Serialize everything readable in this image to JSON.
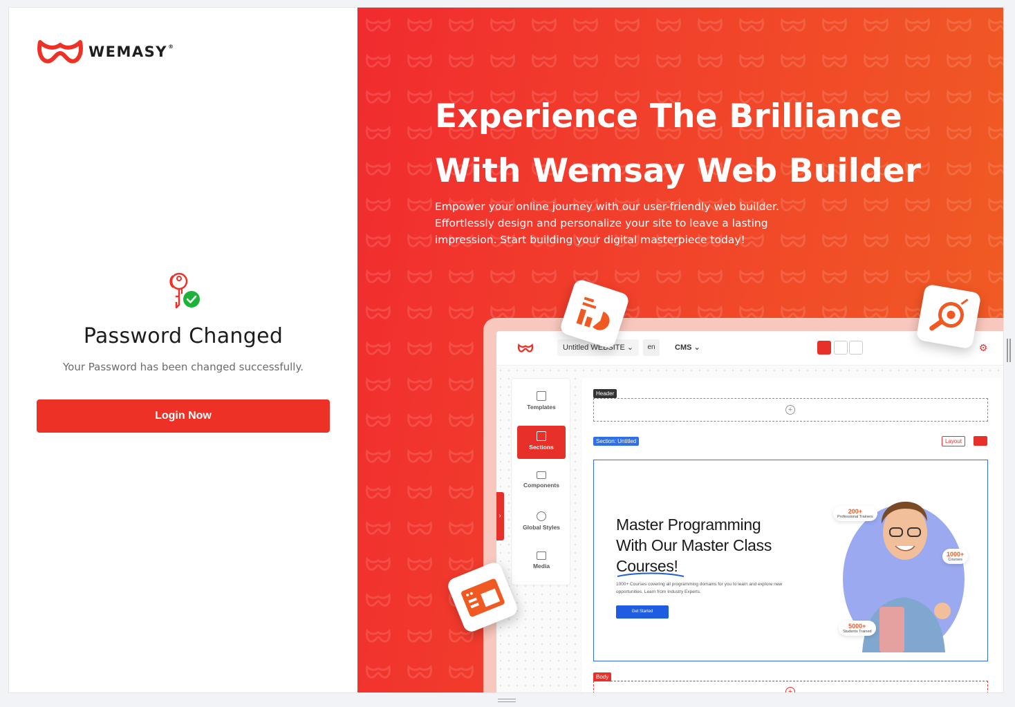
{
  "brand": {
    "name": "WEMASY",
    "reg": "®",
    "color": "#ee3126"
  },
  "success": {
    "title": "Password Changed",
    "message": "Your Password has been changed successfully.",
    "button": "Login Now"
  },
  "hero": {
    "title_line1": "Experience The Brilliance",
    "title_line2": "With Wemsay Web Builder",
    "subtitle": "Empower your online journey with our user-friendly web builder. Effortlessly design and personalize your site to leave a lasting impression. Start building your digital masterpiece today!"
  },
  "builder": {
    "site_name": "Untitled WEBSITE",
    "lang": "en",
    "cms": "CMS",
    "panel": [
      "Templates",
      "Sections",
      "Components",
      "Global Styles",
      "Media"
    ],
    "header_tag": "Header",
    "section_tag": "Section: Untitled",
    "layout_tag": "Layout",
    "body_tag": "Body",
    "section": {
      "title": "Master Programming With Our Master Class Courses!",
      "desc": "1000+ Courses covering all programming domains for you to learn and explore new opportunities. Learn from Industry Experts.",
      "button": "Get Started",
      "badges": [
        {
          "value": "200+",
          "label": "Professional Trainers"
        },
        {
          "value": "1000+",
          "label": "Courses"
        },
        {
          "value": "5000+",
          "label": "Students Trained"
        }
      ]
    }
  },
  "icons": [
    "wemasy-logo-icon",
    "key-icon",
    "check-icon",
    "chevron-down-icon",
    "desktop-icon",
    "tablet-icon",
    "mobile-icon",
    "gear-icon",
    "plus-icon",
    "trash-icon",
    "chevron-right-icon"
  ]
}
